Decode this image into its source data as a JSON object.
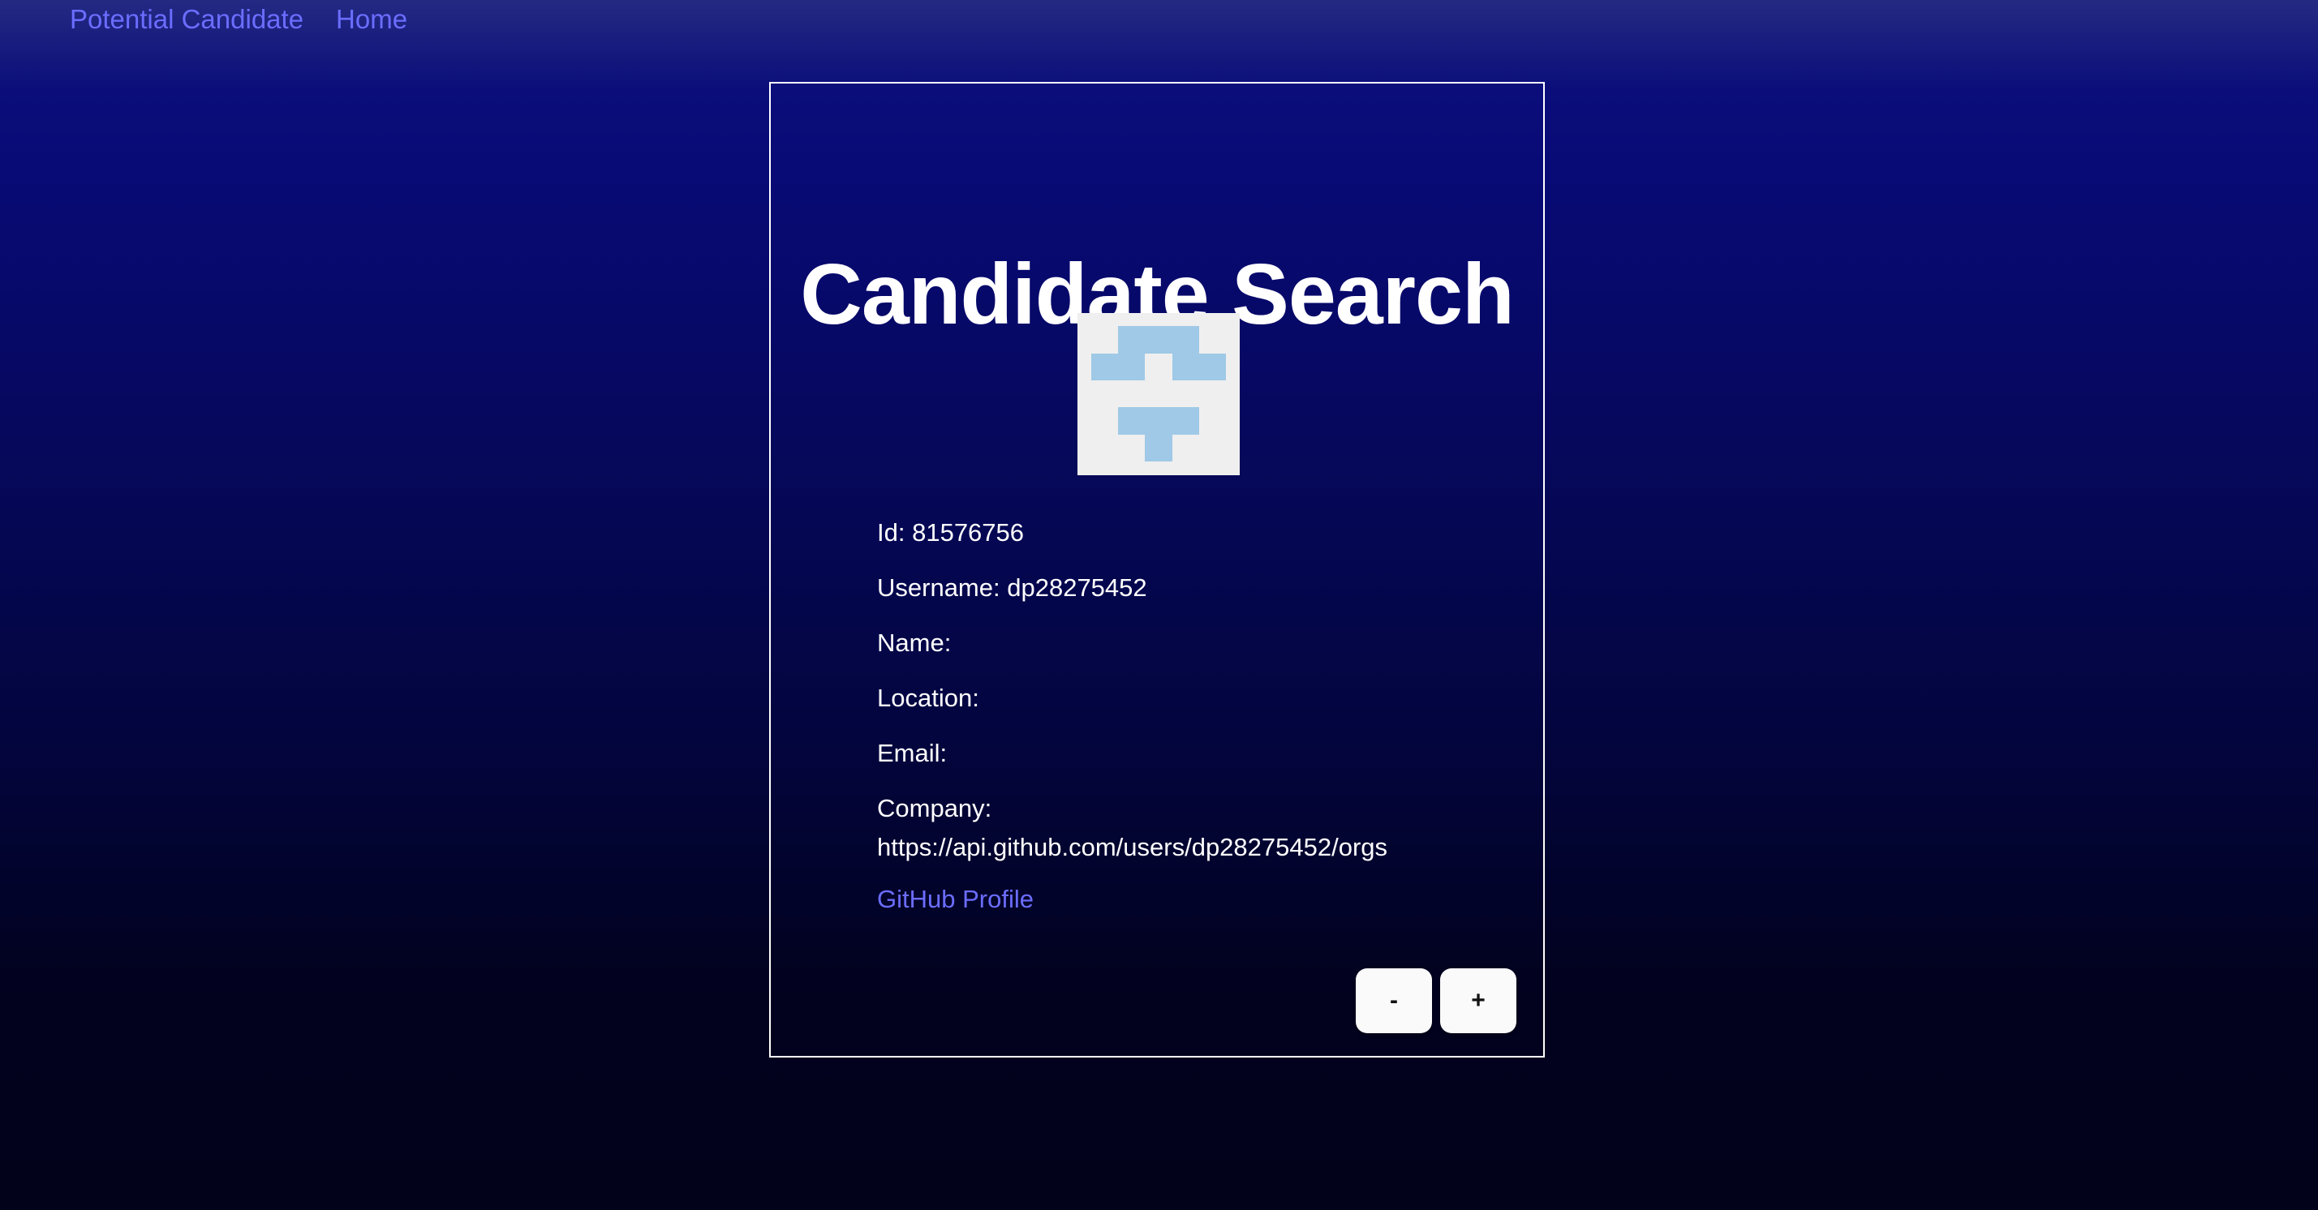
{
  "nav": {
    "items": [
      {
        "label": "Potential Candidate"
      },
      {
        "label": "Home"
      }
    ]
  },
  "card": {
    "title": "Candidate Search",
    "avatar": {
      "icon": "identicon-avatar",
      "background": "#efefef",
      "foreground": "#9fc9e6"
    },
    "fields": {
      "id": {
        "label": "Id:",
        "value": "81576756"
      },
      "username": {
        "label": "Username:",
        "value": "dp28275452"
      },
      "name": {
        "label": "Name:",
        "value": ""
      },
      "location": {
        "label": "Location:",
        "value": ""
      },
      "email": {
        "label": "Email:",
        "value": ""
      },
      "company": {
        "label": "Company:",
        "value": "https://api.github.com/users/dp28275452/orgs"
      }
    },
    "profile_link": "GitHub Profile",
    "buttons": {
      "reject": "-",
      "accept": "+"
    }
  },
  "colors": {
    "link": "#6b6dff",
    "text": "#ffffff",
    "card_border": "#ffffff",
    "button_bg": "#fafafa"
  }
}
